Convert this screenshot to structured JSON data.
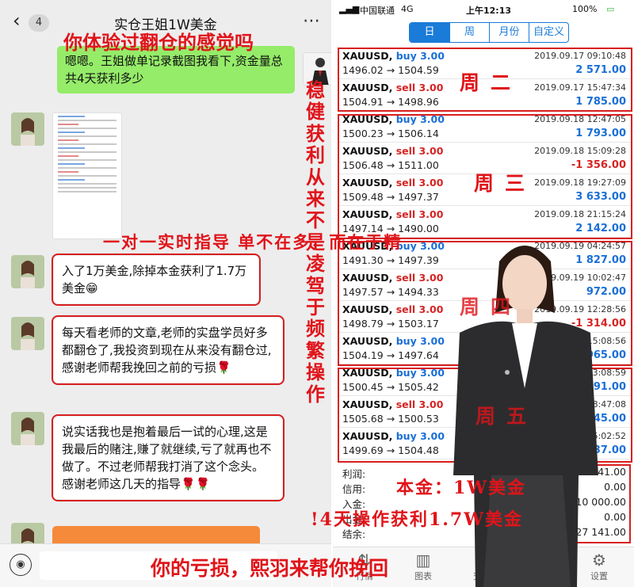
{
  "chat": {
    "title": "实仓王姐1W美金",
    "unread": "4",
    "messages": [
      {
        "text": "嗯嗯。王姐做单记录截图我看下,资金量总共4天获利多少"
      },
      {
        "text": "入了1万美金,除掉本金获利了1.7万美金😁"
      },
      {
        "text": "每天看老师的文章,老师的实盘学员好多都翻仓了,我投资到现在从来没有翻仓过,感谢老师帮我挽回之前的亏损🌹"
      },
      {
        "text": "说实话我也是抱着最后一试的心理,这是我最后的赌注,赚了就继续,亏了就再也不做了。不过老师帮我打消了这个念头。感谢老师这几天的指导🌹🌹"
      }
    ]
  },
  "app": {
    "status_bar": {
      "carrier": "中国联通",
      "network": "4G",
      "time": "上午12:13",
      "battery": "100%"
    },
    "tabs": [
      {
        "label": "日",
        "active": true
      },
      {
        "label": "周",
        "active": false
      },
      {
        "label": "月份",
        "active": false
      },
      {
        "label": "自定义",
        "active": false
      }
    ],
    "trades": [
      {
        "symbol": "XAUUSD,",
        "side": "buy 3.00",
        "type": "buy",
        "prices": "1496.02 → 1504.59",
        "time": "2019.09.17 09:10:48",
        "profit": "2 571.00",
        "sign": "pos"
      },
      {
        "symbol": "XAUUSD,",
        "side": "sell 3.00",
        "type": "sell",
        "prices": "1504.91 → 1498.96",
        "time": "2019.09.17 15:47:34",
        "profit": "1 785.00",
        "sign": "pos"
      },
      {
        "symbol": "XAUUSD,",
        "side": "buy 3.00",
        "type": "buy",
        "prices": "1500.23 → 1506.14",
        "time": "2019.09.18 12:47:05",
        "profit": "1 793.00",
        "sign": "pos"
      },
      {
        "symbol": "XAUUSD,",
        "side": "sell 3.00",
        "type": "sell",
        "prices": "1506.48 → 1511.00",
        "time": "2019.09.18 15:09:28",
        "profit": "-1 356.00",
        "sign": "neg"
      },
      {
        "symbol": "XAUUSD,",
        "side": "sell 3.00",
        "type": "sell",
        "prices": "1509.48 → 1497.37",
        "time": "2019.09.18 19:27:09",
        "profit": "3 633.00",
        "sign": "pos"
      },
      {
        "symbol": "XAUUSD,",
        "side": "sell 3.00",
        "type": "sell",
        "prices": "1497.14 → 1490.00",
        "time": "2019.09.18 21:15:24",
        "profit": "2 142.00",
        "sign": "pos"
      },
      {
        "symbol": "XAUUSD,",
        "side": "buy 3.00",
        "type": "buy",
        "prices": "1491.30 → 1497.39",
        "time": "2019.09.19 04:24:57",
        "profit": "1 827.00",
        "sign": "pos"
      },
      {
        "symbol": "XAUUSD,",
        "side": "sell 3.00",
        "type": "sell",
        "prices": "1497.57 → 1494.33",
        "time": "2019.09.19 10:02:47",
        "profit": "972.00",
        "sign": "pos"
      },
      {
        "symbol": "XAUUSD,",
        "side": "sell 3.00",
        "type": "sell",
        "prices": "1498.79 → 1503.17",
        "time": "2019.09.19 12:28:56",
        "profit": "-1 314.00",
        "sign": "neg"
      },
      {
        "symbol": "XAUUSD,",
        "side": "buy 3.00",
        "type": "buy",
        "prices": "1504.19 → 1497.64",
        "time": "2019.09.19 15:08:56",
        "profit": "1 965.00",
        "sign": "pos"
      },
      {
        "symbol": "XAUUSD,",
        "side": "buy 3.00",
        "type": "buy",
        "prices": "1500.45 → 1505.42",
        "time": "2019.09.20 03:08:59",
        "profit": "1 491.00",
        "sign": "pos"
      },
      {
        "symbol": "XAUUSD,",
        "side": "sell 3.00",
        "type": "sell",
        "prices": "1505.68 → 1500.53",
        "time": "2019.09.20 08:47:08",
        "profit": "1 545.00",
        "sign": "pos"
      },
      {
        "symbol": "XAUUSD,",
        "side": "buy 3.00",
        "type": "buy",
        "prices": "1499.69 → 1504.48",
        "time": "2019.09.20 15:02:52",
        "profit": "1 437.00",
        "sign": "pos"
      }
    ],
    "summary": [
      {
        "label": "利润:",
        "value": "17 141.00"
      },
      {
        "label": "信用:",
        "value": "0.00"
      },
      {
        "label": "入金:",
        "value": "10 000.00"
      },
      {
        "label": "出金:",
        "value": "0.00"
      },
      {
        "label": "结余:",
        "value": "27 141.00"
      }
    ],
    "tabbar": [
      {
        "label": "行情",
        "icon": "quotes-icon",
        "glyph": "⇅"
      },
      {
        "label": "图表",
        "icon": "chart-icon",
        "glyph": "▥"
      },
      {
        "label": "交易",
        "icon": "trade-icon",
        "glyph": "↗"
      },
      {
        "label": "历史",
        "icon": "history-icon",
        "glyph": "▤",
        "active": true
      },
      {
        "label": "设置",
        "icon": "settings-icon",
        "glyph": "⚙"
      }
    ]
  },
  "overlay": {
    "title": "你体验过翻仓的感觉吗",
    "vertical": [
      "稳",
      "健",
      "获",
      "利",
      "从",
      "来",
      "不",
      "是",
      "凌",
      "驾",
      "于",
      "频",
      "繁",
      "操",
      "作"
    ],
    "mid": "一对一实时指导   单不在多，而在于精",
    "day_tue": "周二",
    "day_wed": "周三",
    "day_thu": "周四",
    "day_fri": "周五",
    "capital": "本金：1W美金",
    "profit": "!4天操作获利1.7W美金",
    "bottom": "你的亏损，熙羽来帮你挽回"
  },
  "colors": {
    "accent": "#1a7bd8",
    "profit_pos": "#1a6fd6",
    "profit_neg": "#d62424",
    "overlay_red": "#e0141a",
    "wechat_green": "#95ec69"
  }
}
